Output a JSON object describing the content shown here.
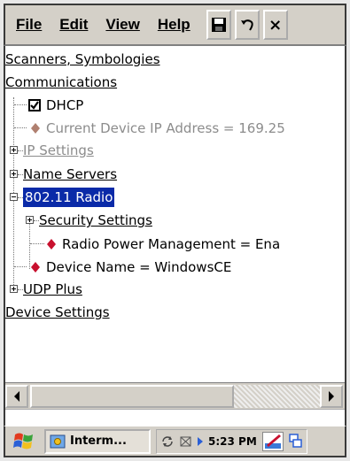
{
  "menu": {
    "file": "File",
    "edit": "Edit",
    "view": "View",
    "help": "Help"
  },
  "toolbar": {
    "save_icon": "floppy-disk-icon",
    "undo_icon": "undo-icon",
    "close_label": "×"
  },
  "tree": {
    "scanners": "Scanners, Symbologies",
    "communications": "Communications",
    "dhcp": "DHCP",
    "current_ip": "Current Device IP Address = 169.25",
    "ip_settings": "IP Settings",
    "name_servers": "Name Servers",
    "radio": "802.11 Radio",
    "security": "Security Settings",
    "radio_power": "Radio Power Management = Ena",
    "device_name": "Device Name = WindowsCE",
    "udp_plus": "UDP Plus",
    "device_settings": "Device Settings"
  },
  "taskbar": {
    "task_label": "Interm...",
    "time": "5:23 PM"
  },
  "colors": {
    "selection": "#0a2aa8",
    "diamond": "#c8102e",
    "diamond_disabled": "#b08070",
    "chrome": "#d4d0c8"
  }
}
